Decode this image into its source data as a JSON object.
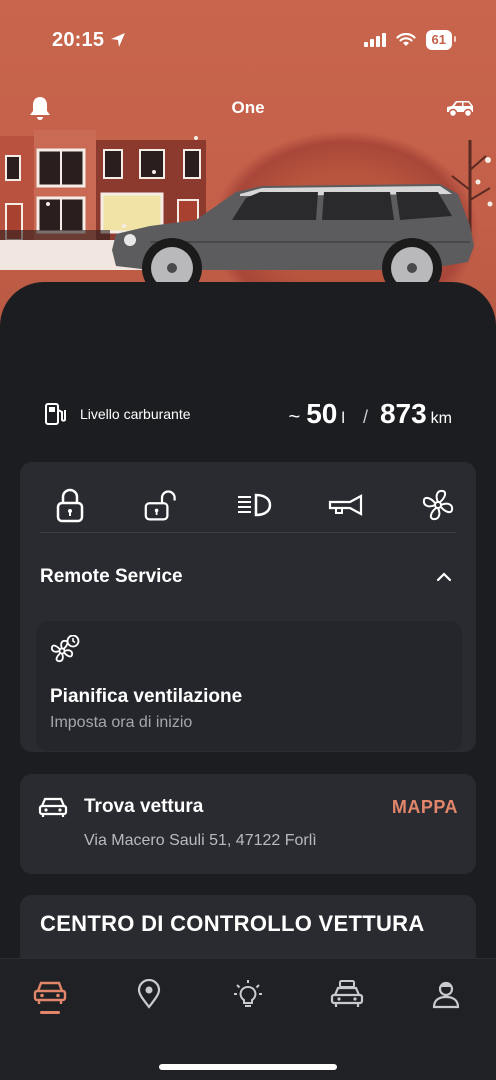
{
  "status_bar": {
    "time": "20:15",
    "battery": "61"
  },
  "header": {
    "title": "One"
  },
  "fuel": {
    "label": "Livello carburante",
    "tilde": "~",
    "liters": "50",
    "liters_unit": "l",
    "separator": "/",
    "range": "873",
    "range_unit": "km"
  },
  "remote_service": {
    "title": "Remote Service",
    "quick_actions": [
      {
        "icon": "lock-icon"
      },
      {
        "icon": "unlock-icon"
      },
      {
        "icon": "headlight-icon"
      },
      {
        "icon": "horn-icon"
      },
      {
        "icon": "fan-icon"
      }
    ],
    "schedule": {
      "title": "Pianifica ventilazione",
      "subtitle": "Imposta ora di inizio"
    }
  },
  "find_vehicle": {
    "title": "Trova vettura",
    "link": "MAPPA",
    "address": "Via Macero Sauli 51, 47122 Forlì"
  },
  "control_center": {
    "title": "CENTRO DI CONTROLLO VETTURA"
  },
  "tabbar": {
    "tabs": [
      {
        "icon": "car-front-icon",
        "active": true
      },
      {
        "icon": "map-pin-icon",
        "active": false
      },
      {
        "icon": "lightbulb-icon",
        "active": false
      },
      {
        "icon": "car-service-icon",
        "active": false
      },
      {
        "icon": "profile-icon",
        "active": false
      }
    ]
  },
  "colors": {
    "accent": "#e2866b",
    "hero": "#c4604a",
    "background": "#1c1d21",
    "card": "#2a2b30"
  }
}
